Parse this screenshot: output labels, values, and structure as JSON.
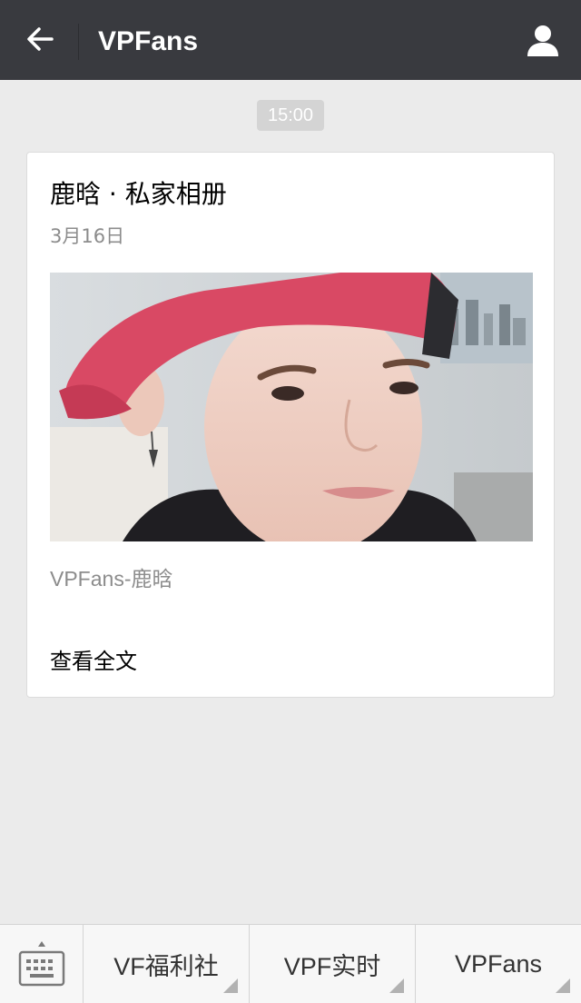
{
  "header": {
    "back_icon": "arrow-left-icon",
    "title": "VPFans",
    "profile_icon": "user-icon"
  },
  "chat": {
    "timestamp": "15:00"
  },
  "article": {
    "title": "鹿晗 · 私家相册",
    "date": "3月16日",
    "image_subject": "selfie photo of person in red cap",
    "description": "VPFans-鹿晗",
    "read_more": "查看全文"
  },
  "bottom_menu": {
    "keyboard_icon": "keyboard-icon",
    "items": [
      {
        "label": "VF福利社"
      },
      {
        "label": "VPF实时"
      },
      {
        "label": "VPFans"
      }
    ]
  },
  "colors": {
    "header_bg": "#393a3f",
    "page_bg": "#ebebeb",
    "card_bg": "#ffffff",
    "muted_text": "#8c8c8c",
    "menu_bg": "#f7f7f7"
  }
}
